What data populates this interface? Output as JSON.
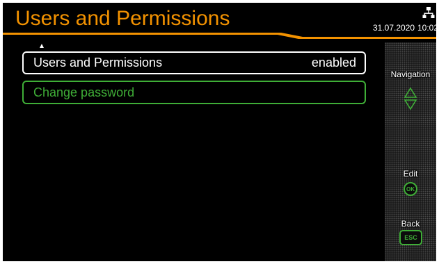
{
  "header": {
    "title": "Users and Permissions",
    "date": "31.07.2020",
    "time": "10:02",
    "status_icon": "network-icon"
  },
  "colors": {
    "accent": "#f39200",
    "selection": "#3fae37",
    "background": "#000000",
    "text": "#ffffff"
  },
  "menu": {
    "items": [
      {
        "label": "Users and Permissions",
        "value": "enabled",
        "selected": false
      },
      {
        "label": "Change password",
        "value": "",
        "selected": true
      }
    ]
  },
  "softkeys": {
    "navigation_label": "Navigation",
    "navigation_icon": "up-down-arrows-icon",
    "edit_label": "Edit",
    "ok_key": "OK",
    "back_label": "Back",
    "esc_key": "ESC"
  }
}
